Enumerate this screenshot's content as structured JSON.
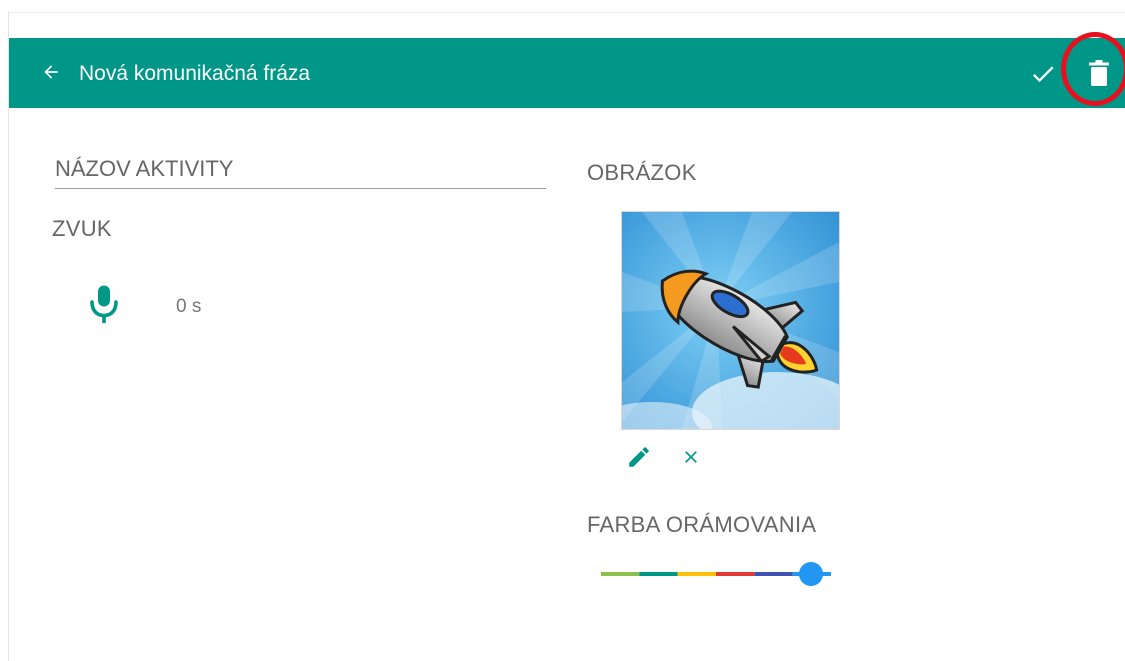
{
  "toolbar": {
    "title": "Nová komunikačná fráza",
    "background_color": "#009688",
    "back_icon": "arrow-back-icon",
    "save_icon": "check-icon",
    "delete_icon": "trash-icon"
  },
  "form": {
    "name_placeholder": "NÁZOV AKTIVITY",
    "name_value": "",
    "sound_label": "ZVUK",
    "sound_duration": "0 s",
    "mic_icon": "microphone-icon",
    "picture_label": "OBRÁZOK",
    "edit_picture_icon": "pencil-icon",
    "remove_picture_icon": "close-icon",
    "border_color_label": "FARBA ORÁMOVANIA",
    "border_color_options": [
      "#8bc34a",
      "#009688",
      "#ffc107",
      "#e53935",
      "#3f51b5",
      "#2196f3"
    ],
    "border_color_selected": "#2196f3"
  },
  "annotation": {
    "highlight_color": "#e8101e"
  }
}
